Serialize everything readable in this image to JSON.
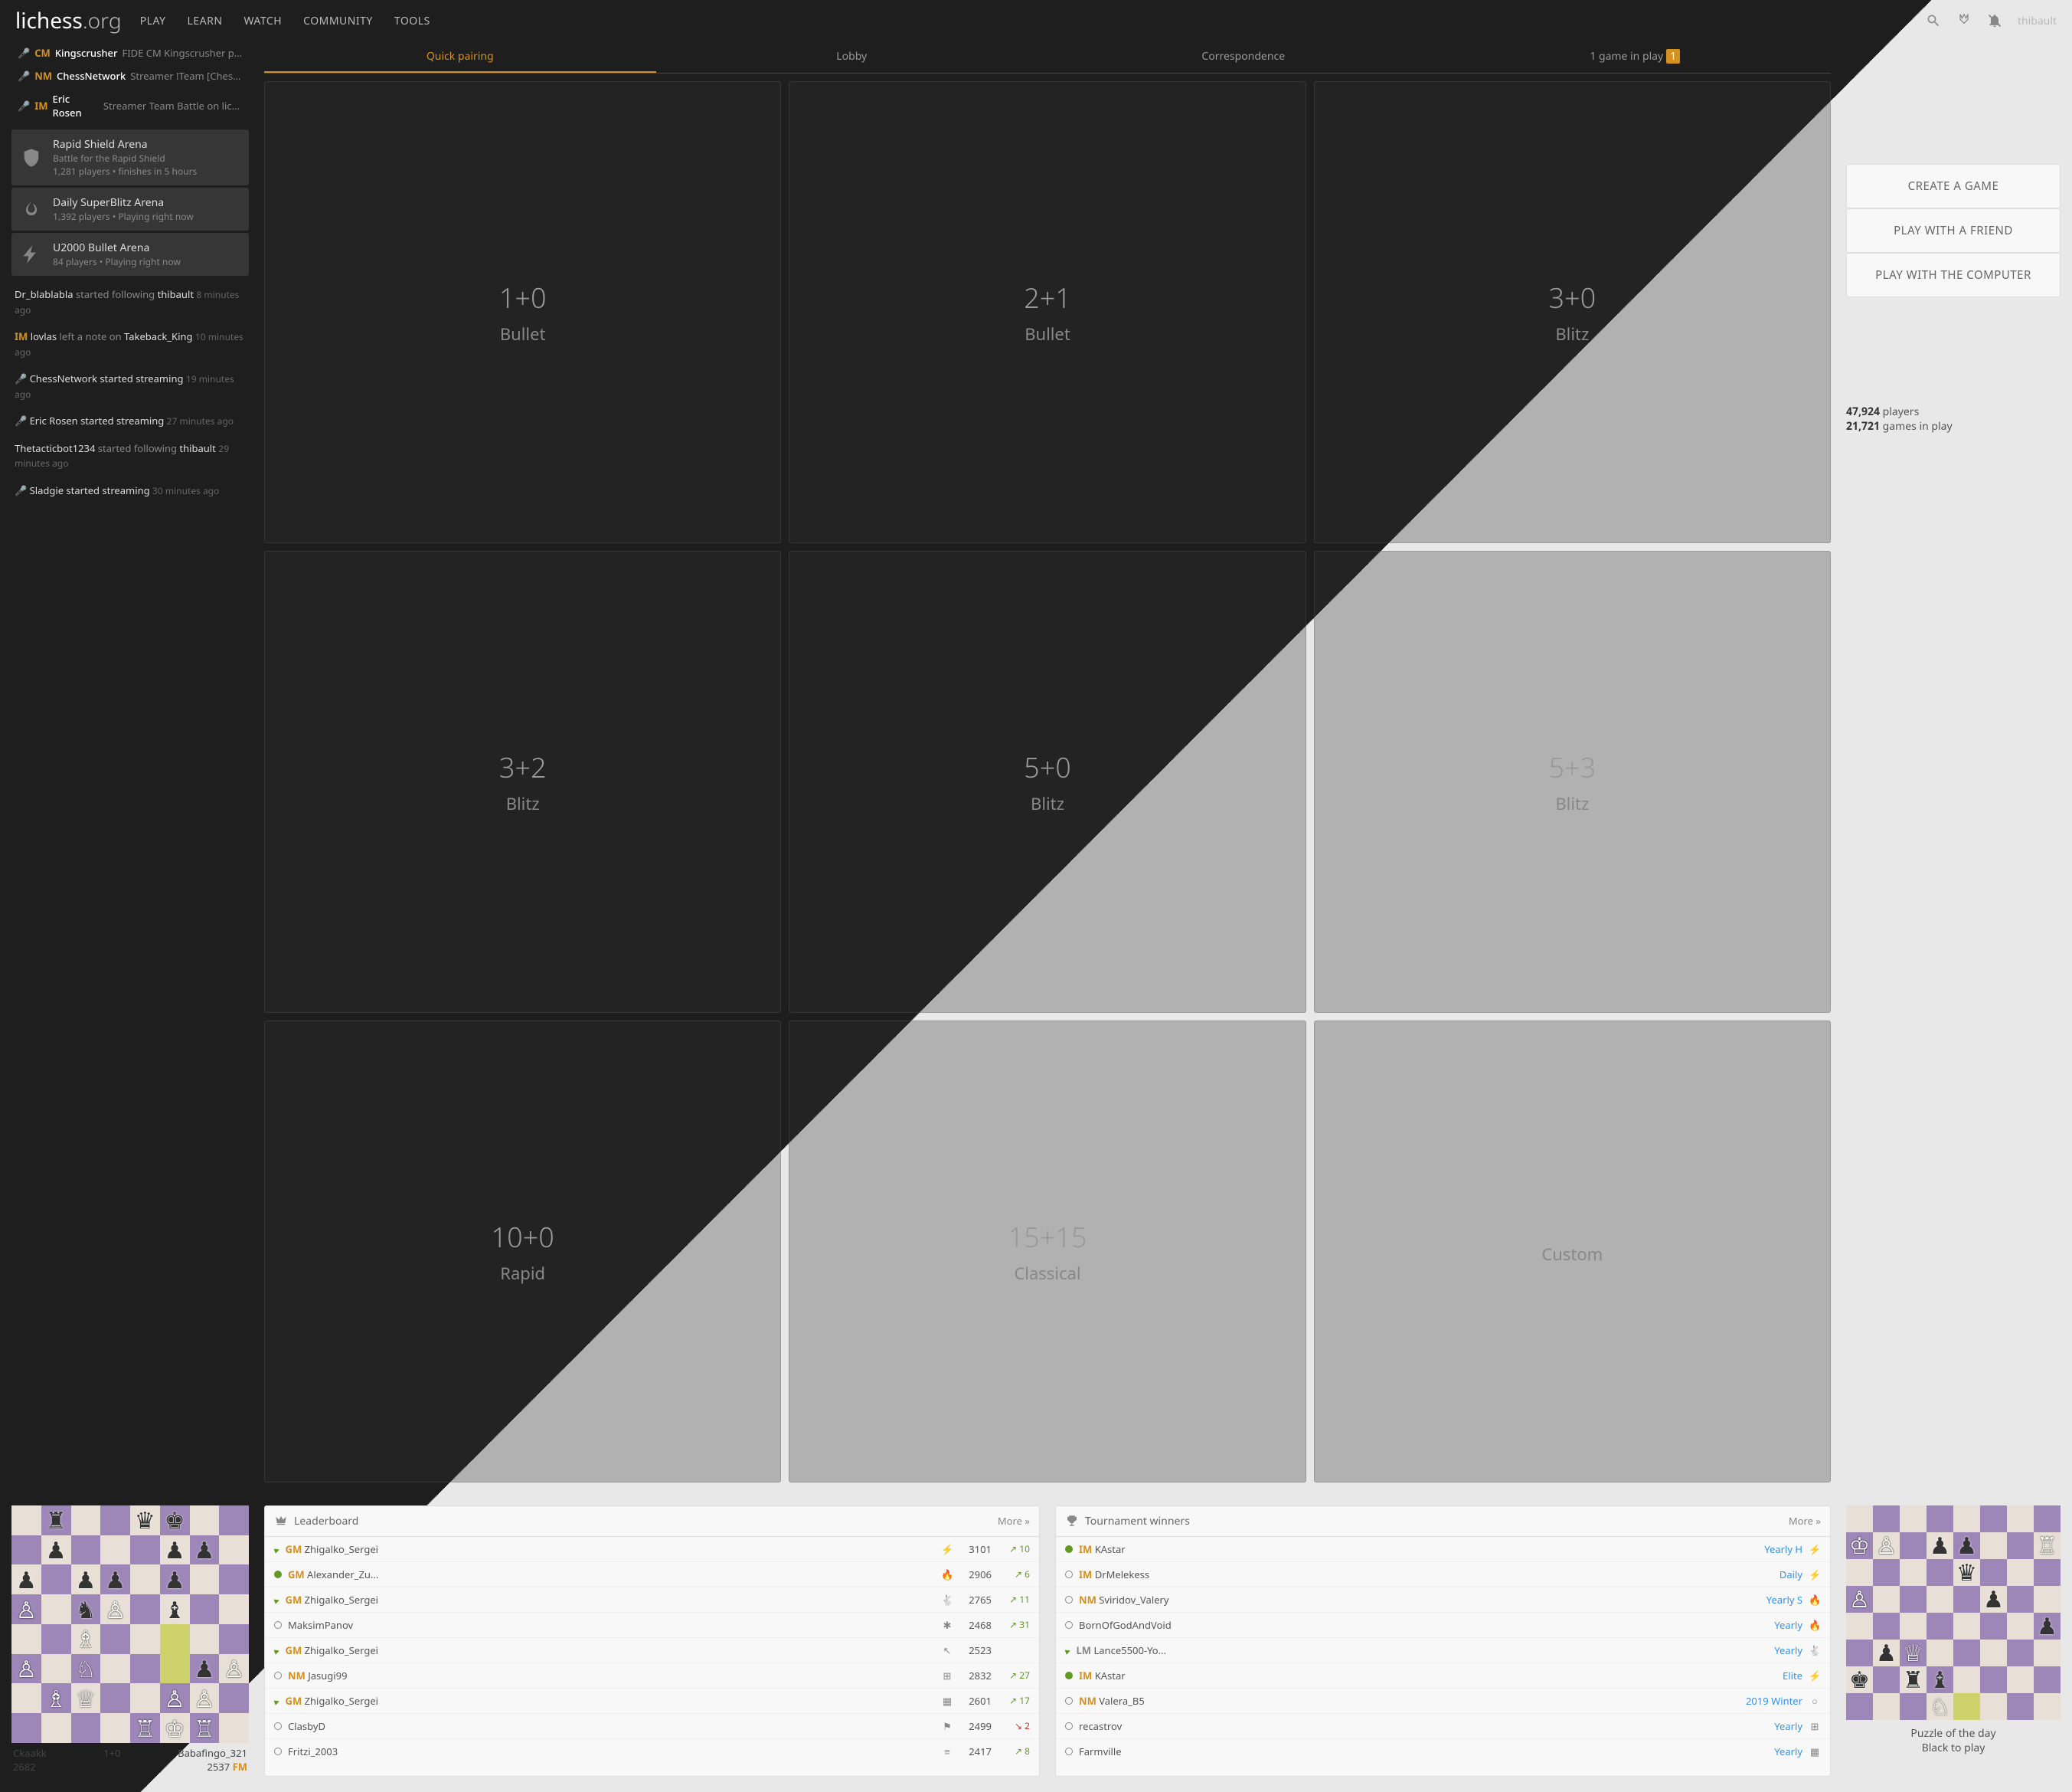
{
  "header": {
    "logo1": "lichess",
    "logo2": ".org",
    "nav": [
      "PLAY",
      "LEARN",
      "WATCH",
      "COMMUNITY",
      "TOOLS"
    ],
    "user": "thibault"
  },
  "streams": [
    {
      "title": "CM",
      "name": "Kingscrusher",
      "desc": "FIDE CM Kingscrusher pla..."
    },
    {
      "title": "NM",
      "name": "ChessNetwork",
      "desc": "Streamer !Team [Chess..."
    },
    {
      "title": "IM",
      "name": "Eric Rosen",
      "desc": "Streamer Team Battle on liche..."
    }
  ],
  "tournaments": [
    {
      "icon": "shield",
      "name": "Rapid Shield Arena",
      "desc": "Battle for the Rapid Shield",
      "meta": "1,281 players • finishes",
      "time": "in 5 hours"
    },
    {
      "icon": "flame",
      "name": "Daily SuperBlitz Arena",
      "desc": "1,392 players • Playing right now",
      "meta": "",
      "time": ""
    },
    {
      "icon": "bolt",
      "name": "U2000 Bullet Arena",
      "desc": "84 players • Playing right now",
      "meta": "",
      "time": ""
    }
  ],
  "feed": [
    {
      "u1": "Dr_blablabla",
      "txt": " started following ",
      "u2": "thibault",
      "time": "8 minutes ago"
    },
    {
      "title": "IM",
      "u1": "lovlas",
      "txt": " left a note on ",
      "u2": "Takeback_King",
      "time": "10 minutes ago"
    },
    {
      "mic": true,
      "u1": "ChessNetwork started streaming",
      "time": "19 minutes ago"
    },
    {
      "mic": true,
      "u1": "Eric Rosen started streaming",
      "time": "27 minutes ago"
    },
    {
      "u1": "Thetacticbot1234",
      "txt": " started following ",
      "u2": "thibault",
      "time": "29 minutes ago"
    },
    {
      "mic": true,
      "u1": "Sladgie started streaming",
      "time": "30 minutes ago"
    }
  ],
  "tabs": [
    {
      "label": "Quick pairing",
      "active": true
    },
    {
      "label": "Lobby"
    },
    {
      "label": "Correspondence"
    },
    {
      "label": "1 game in play",
      "badge": "1"
    }
  ],
  "pool": [
    {
      "t": "1+0",
      "n": "Bullet"
    },
    {
      "t": "2+1",
      "n": "Bullet"
    },
    {
      "t": "3+0",
      "n": "Blitz"
    },
    {
      "t": "3+2",
      "n": "Blitz"
    },
    {
      "t": "5+0",
      "n": "Blitz"
    },
    {
      "t": "5+3",
      "n": "Blitz"
    },
    {
      "t": "10+0",
      "n": "Rapid"
    },
    {
      "t": "15+15",
      "n": "Classical"
    },
    {
      "t": "",
      "n": "Custom"
    }
  ],
  "buttons": [
    "CREATE A GAME",
    "PLAY WITH A FRIEND",
    "PLAY WITH THE COMPUTER"
  ],
  "stats": {
    "players": "47,924",
    "games": "21,721",
    "pl": " players",
    "gl": " games in play"
  },
  "game": {
    "w": "Ckaakk",
    "wr": "2682",
    "tc": "1+0",
    "b": "Babafingo_321",
    "br": "2537",
    "bt": "FM"
  },
  "lb": {
    "title": "Leaderboard",
    "more": "More »",
    "rows": [
      {
        "on": false,
        "wing": true,
        "t": "GM",
        "n": "Zhigalko_Sergei",
        "i": "⚡",
        "r": "3101",
        "d": "10",
        "up": true
      },
      {
        "on": true,
        "t": "GM",
        "n": "Alexander_Zu...",
        "i": "🔥",
        "r": "2906",
        "d": "6",
        "up": true
      },
      {
        "on": false,
        "wing": true,
        "t": "GM",
        "n": "Zhigalko_Sergei",
        "i": "🐇",
        "r": "2765",
        "d": "11",
        "up": true
      },
      {
        "on": false,
        "n": "MaksimPanov",
        "i": "✱",
        "r": "2468",
        "d": "31",
        "up": true
      },
      {
        "on": false,
        "wing": true,
        "t": "GM",
        "n": "Zhigalko_Sergei",
        "i": "↖",
        "r": "2523",
        "d": "",
        "up": true
      },
      {
        "on": false,
        "t": "NM",
        "n": "Jasugi99",
        "i": "⊞",
        "r": "2832",
        "d": "27",
        "up": true
      },
      {
        "on": false,
        "wing": true,
        "t": "GM",
        "n": "Zhigalko_Sergei",
        "i": "▦",
        "r": "2601",
        "d": "17",
        "up": true
      },
      {
        "on": false,
        "n": "ClasbyD",
        "i": "⚑",
        "r": "2499",
        "d": "2",
        "up": false
      },
      {
        "on": false,
        "n": "Fritzi_2003",
        "i": "≡",
        "r": "2417",
        "d": "8",
        "up": true
      }
    ]
  },
  "tw": {
    "title": "Tournament winners",
    "more": "More »",
    "rows": [
      {
        "on": true,
        "t": "IM",
        "n": "KAstar",
        "tour": "Yearly H",
        "i": "⚡"
      },
      {
        "on": false,
        "t": "IM",
        "n": "DrMelekess",
        "tour": "Daily",
        "i": "⚡"
      },
      {
        "on": false,
        "t": "NM",
        "n": "Sviridov_Valery",
        "tour": "Yearly S",
        "i": "🔥"
      },
      {
        "on": false,
        "n": "BornOfGodAndVoid",
        "tour": "Yearly",
        "i": "🔥"
      },
      {
        "on": false,
        "wing": true,
        "t": "LM",
        "n": "Lance5500-Yo...",
        "tour": "Yearly",
        "i": "🐇"
      },
      {
        "on": true,
        "t": "IM",
        "n": "KAstar",
        "tour": "Elite",
        "i": "⚡"
      },
      {
        "on": false,
        "t": "NM",
        "n": "Valera_B5",
        "tour": "2019 Winter",
        "i": "○"
      },
      {
        "on": false,
        "n": "recastrov",
        "tour": "Yearly",
        "i": "⊞"
      },
      {
        "on": false,
        "n": "Farmville",
        "tour": "Yearly",
        "i": "▦"
      }
    ]
  },
  "puzzle": {
    "l1": "Puzzle of the day",
    "l2": "Black to play"
  }
}
